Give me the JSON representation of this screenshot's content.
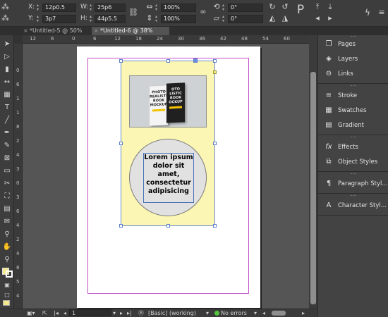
{
  "control_bar": {
    "x_label": "X:",
    "x_value": "12p0.5",
    "y_label": "Y:",
    "y_value": "3p7",
    "w_label": "W:",
    "w_value": "25p6",
    "h_label": "H:",
    "h_value": "44p5.5",
    "scale_x": "100%",
    "scale_y": "100%",
    "rotate": "0°",
    "shear": "0°"
  },
  "tabs": [
    {
      "label": "*Untitled-5 @ 50%",
      "active": false
    },
    {
      "label": "*Untitled-6 @ 38%",
      "active": true
    }
  ],
  "ruler": {
    "h_ticks": [
      "12",
      "6",
      "0",
      "6",
      "12",
      "18",
      "24",
      "30",
      "36",
      "42",
      "48",
      "54",
      "60"
    ],
    "v_ticks": [
      "0",
      "6",
      "1",
      "1",
      "8",
      "2",
      "4",
      "3",
      "0",
      "3",
      "6",
      "4",
      "2",
      "4",
      "8",
      "5",
      "4"
    ]
  },
  "canvas": {
    "book_white_text": "PHOTO REALISTIC BOOK MOCKUP",
    "book_black_text": "OTO LISTIC BOOK OCKUP",
    "body_text": "Lorem ipsum dolor sit amet, consectetur adipisicing",
    "colors": {
      "background_frame": "#fbf6b3",
      "margin_guide": "#c24ec9",
      "selection": "#6b8dd6"
    }
  },
  "status_bar": {
    "page": "1",
    "style": "[Basic] (working)",
    "preflight": "No errors"
  },
  "panels": [
    {
      "icon": "pages-icon",
      "label": "Pages"
    },
    {
      "icon": "layers-icon",
      "label": "Layers"
    },
    {
      "icon": "links-icon",
      "label": "Links"
    },
    {
      "icon": "stroke-icon",
      "label": "Stroke"
    },
    {
      "icon": "swatches-icon",
      "label": "Swatches"
    },
    {
      "icon": "gradient-icon",
      "label": "Gradient"
    },
    {
      "icon": "effects-icon",
      "label": "Effects"
    },
    {
      "icon": "object-styles-icon",
      "label": "Object Styles"
    },
    {
      "icon": "paragraph-styles-icon",
      "label": "Paragraph Styl..."
    },
    {
      "icon": "character-styles-icon",
      "label": "Character Styl..."
    }
  ]
}
